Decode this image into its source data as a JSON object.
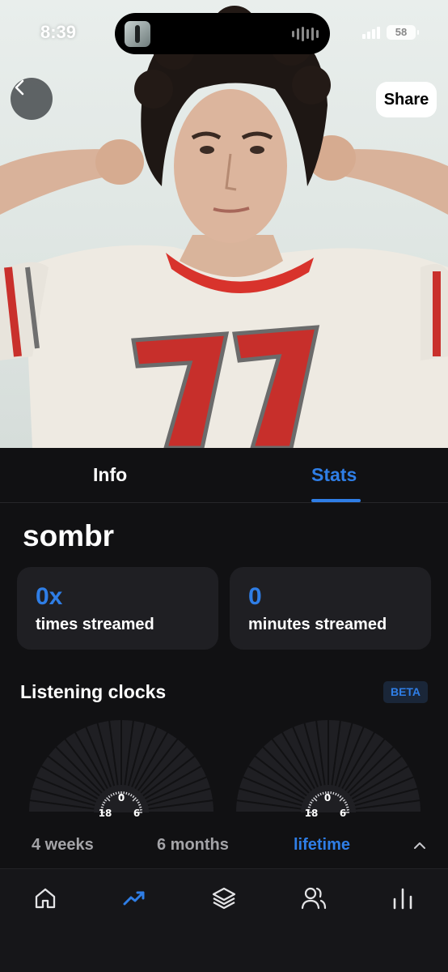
{
  "status_bar": {
    "time": "8:39",
    "battery": "58"
  },
  "header": {
    "back_icon": "chevron-left-icon",
    "share_label": "Share"
  },
  "tabs": [
    {
      "label": "Info",
      "active": false
    },
    {
      "label": "Stats",
      "active": true
    }
  ],
  "artist": {
    "name": "sombr"
  },
  "stats": [
    {
      "value": "0x",
      "label": "times streamed"
    },
    {
      "value": "0",
      "label": "minutes streamed"
    }
  ],
  "listening_clocks": {
    "title": "Listening clocks",
    "badge": "BETA",
    "clock_labels": {
      "top": "0",
      "left": "18",
      "right": "6"
    },
    "periods": [
      {
        "label": "4 weeks",
        "active": false
      },
      {
        "label": "6 months",
        "active": false
      },
      {
        "label": "lifetime",
        "active": true
      }
    ],
    "collapse_icon": "chevron-up-icon"
  },
  "bottom_nav": [
    {
      "icon": "home-icon",
      "active": false
    },
    {
      "icon": "trending-icon",
      "active": true
    },
    {
      "icon": "layers-icon",
      "active": false
    },
    {
      "icon": "users-icon",
      "active": false
    },
    {
      "icon": "bar-chart-icon",
      "active": false
    }
  ],
  "colors": {
    "accent": "#2f7ee6",
    "background": "#111113",
    "card": "#1f1f23",
    "muted_text": "#a4a4a8"
  }
}
